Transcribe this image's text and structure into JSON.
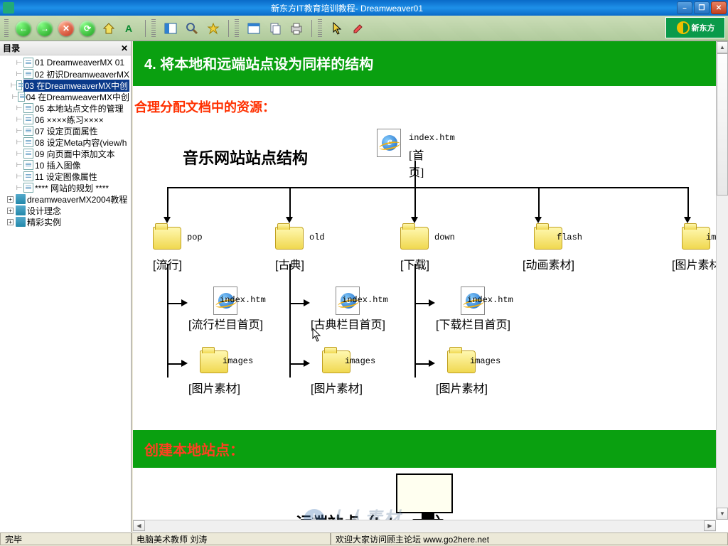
{
  "window": {
    "title": "新东方IT教育培训教程- Dreamweaver01"
  },
  "logo": "新东方",
  "sidebar": {
    "header": "目录",
    "items": [
      {
        "icon": "page",
        "label": "01 DreamweaverMX 01",
        "indent": 1
      },
      {
        "icon": "page",
        "label": "02 初识DreamweaverMX",
        "indent": 1
      },
      {
        "icon": "page",
        "label": "03 在DreamweaverMX中创",
        "indent": 1,
        "selected": true
      },
      {
        "icon": "page",
        "label": "04 在DreamweaverMX中创",
        "indent": 1
      },
      {
        "icon": "page",
        "label": "05 本地站点文件的管理",
        "indent": 1
      },
      {
        "icon": "page",
        "label": "06 ××××练习××××",
        "indent": 1
      },
      {
        "icon": "page",
        "label": "07 设定页面属性",
        "indent": 1
      },
      {
        "icon": "page",
        "label": "08 设定Meta内容(view/h",
        "indent": 1
      },
      {
        "icon": "page",
        "label": "09 向页面中添加文本",
        "indent": 1
      },
      {
        "icon": "page",
        "label": "10 插入图像",
        "indent": 1
      },
      {
        "icon": "page",
        "label": "11 设定图像属性",
        "indent": 1
      },
      {
        "icon": "page",
        "label": "**** 网站的规划 ****",
        "indent": 1
      },
      {
        "icon": "book",
        "label": "dreamweaverMX2004教程",
        "indent": 0,
        "expander": "+"
      },
      {
        "icon": "book",
        "label": "设计理念",
        "indent": 0,
        "expander": "+"
      },
      {
        "icon": "book",
        "label": "精彩实例",
        "indent": 0,
        "expander": "+"
      }
    ]
  },
  "content": {
    "heading4": "4. 将本地和远端站点设为同样的结构",
    "subheading": "合理分配文档中的资源：",
    "diagram_title": "音乐网站站点结构",
    "root": {
      "file": "index.htm",
      "caption": "[首页]"
    },
    "level2": [
      {
        "file": "pop",
        "caption": "[流行]"
      },
      {
        "file": "old",
        "caption": "[古典]"
      },
      {
        "file": "down",
        "caption": "[下载]"
      },
      {
        "file": "flash",
        "caption": "[动画素材]"
      },
      {
        "file": "images",
        "caption": "[图片素材"
      }
    ],
    "level3_index": [
      {
        "file": "index.htm",
        "caption": "[流行栏目首页]"
      },
      {
        "file": "index.htm",
        "caption": "[古典栏目首页]"
      },
      {
        "file": "index.htm",
        "caption": "[下载栏目首页]"
      }
    ],
    "level3_images": [
      {
        "file": "images",
        "caption": "[图片素材]"
      },
      {
        "file": "images",
        "caption": "[图片素材]"
      },
      {
        "file": "images",
        "caption": "[图片素材]"
      }
    ],
    "section2": "创建本地站点：",
    "remote_label": "远端站点（Intennet）"
  },
  "status": {
    "left": "完毕",
    "mid": "电脑美术教师 刘涛",
    "right": "欢迎大家访问顾主论坛 www.go2here.net"
  },
  "watermark": "人人素材"
}
